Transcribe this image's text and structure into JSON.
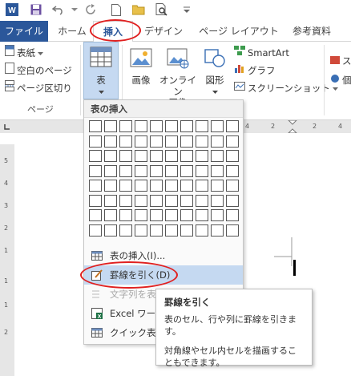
{
  "colors": {
    "file_tab_bg": "#2b579a",
    "accent": "#2b579a",
    "highlight": "#c5d9f1",
    "annotation_red": "#e02020"
  },
  "quick_access": {
    "icons": [
      "word-icon",
      "save-icon",
      "undo-icon",
      "redo-icon",
      "new-document-icon",
      "open-folder-icon",
      "print-preview-icon",
      "customize-dropdown-icon"
    ]
  },
  "tabs": [
    {
      "label": "ファイル"
    },
    {
      "label": "ホーム"
    },
    {
      "label": "挿入"
    },
    {
      "label": "デザイン"
    },
    {
      "label": "ページ レイアウト"
    },
    {
      "label": "参考資料"
    }
  ],
  "ribbon": {
    "pages_group": {
      "items": [
        "表紙",
        "空白のページ",
        "ページ区切り"
      ],
      "label": "ページ"
    },
    "table_button": {
      "label": "表"
    },
    "picture_button": {
      "label": "画像"
    },
    "online_picture_button": {
      "label_line1": "オンライン",
      "label_line2": "画像"
    },
    "shapes_button": {
      "label": "図形"
    },
    "smartart": {
      "label": "SmartArt"
    },
    "chart": {
      "label": "グラフ"
    },
    "screenshot": {
      "label": "スクリーンショット"
    },
    "right_cut_label1": "ス",
    "right_cut_label2": "個"
  },
  "ruler": {
    "h_numbers": [
      "4",
      "2",
      "2",
      "4"
    ],
    "v_numbers": [
      "5",
      "4",
      "3",
      "2",
      "1",
      "1",
      "1",
      "2"
    ]
  },
  "dropdown": {
    "header": "表の挿入",
    "grid_rows": 8,
    "grid_cols": 10,
    "items": [
      {
        "label": "表の挿入(I)...",
        "icon": "table-icon",
        "disabled": false
      },
      {
        "label": "罫線を引く(D)",
        "icon": "pencil-icon",
        "disabled": false
      },
      {
        "label": "文字列を表",
        "icon": "convert-text-icon",
        "disabled": true
      },
      {
        "label": "Excel ワー",
        "icon": "excel-icon",
        "disabled": false
      },
      {
        "label": "クイック表作",
        "icon": "quick-table-icon",
        "disabled": false
      }
    ]
  },
  "tooltip": {
    "title": "罫線を引く",
    "line1": "表のセル、行や列に罫線を引きます。",
    "line2": "対角線やセル内セルを描画することもできます。"
  }
}
